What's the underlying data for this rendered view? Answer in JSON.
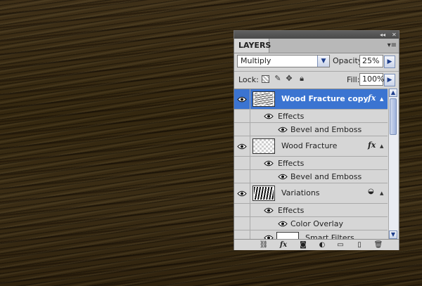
{
  "panel": {
    "tab_label": "LAYERS",
    "blend_mode": "Multiply",
    "opacity_label": "Opacity:",
    "opacity_value": "25%",
    "lock_label": "Lock:",
    "fill_label": "Fill:",
    "fill_value": "100%"
  },
  "layers": [
    {
      "name": "Wood Fracture copy",
      "selected": true,
      "has_fx": true,
      "effects_label": "Effects",
      "effects": [
        "Bevel and Emboss"
      ]
    },
    {
      "name": "Wood Fracture",
      "selected": false,
      "has_fx": true,
      "effects_label": "Effects",
      "effects": [
        "Bevel and Emboss"
      ]
    },
    {
      "name": "Variations",
      "selected": false,
      "has_smart_object": true,
      "effects_label": "Effects",
      "effects": [
        "Color Overlay"
      ]
    },
    {
      "name": "Smart Filters",
      "selected": false
    }
  ],
  "footer_icons": [
    "link-icon",
    "fx-icon",
    "mask-icon",
    "adjustment-icon",
    "group-icon",
    "new-layer-icon",
    "trash-icon"
  ],
  "colors": {
    "selection": "#3b74d1",
    "panel": "#d6d6d6",
    "wood": "#3a2c16"
  }
}
